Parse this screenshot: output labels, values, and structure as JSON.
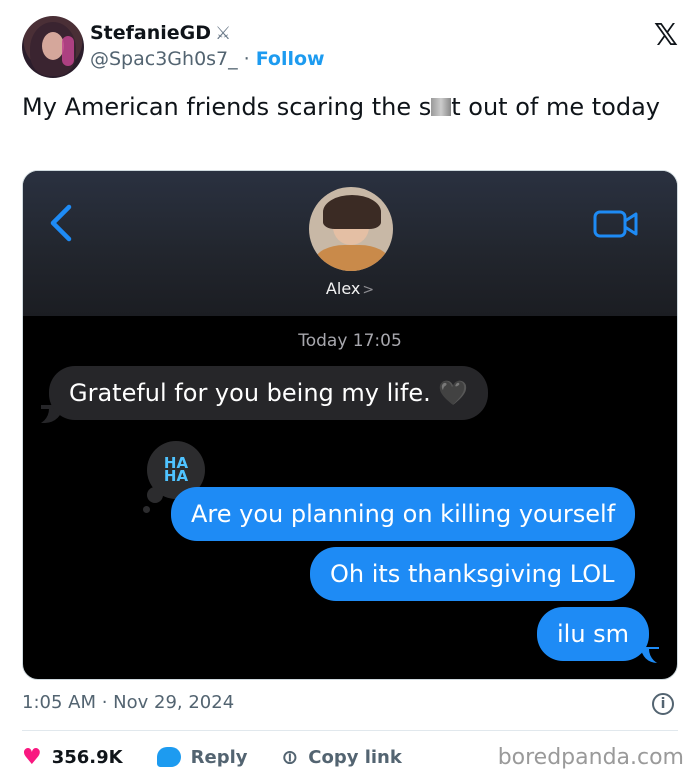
{
  "author": {
    "display_name": "StefanieGD",
    "badge_icon": "crossed-swords-icon",
    "handle": "@Spac3Gh0s7_",
    "separator": "·",
    "follow_label": "Follow"
  },
  "platform_logo": "𝕏",
  "tweet": {
    "text_before": "My American friends scaring the s",
    "text_after": "t out of me today"
  },
  "chat": {
    "contact_name": "Alex",
    "contact_chevron": ">",
    "timestamp": "Today 17:05",
    "messages": [
      {
        "direction": "incoming",
        "text": "Grateful for you being my life. 🖤"
      },
      {
        "direction": "outgoing",
        "text": "Are you planning on killing yourself"
      },
      {
        "direction": "outgoing",
        "text": "Oh its thanksgiving LOL"
      },
      {
        "direction": "outgoing",
        "text": "ilu sm"
      }
    ],
    "reaction": {
      "line1": "HA",
      "line2": "HA"
    }
  },
  "meta": {
    "time_date": "1:05 AM · Nov 29, 2024",
    "info": "i"
  },
  "actions": {
    "likes": "356.9K",
    "reply_label": "Reply",
    "copy_link_label": "Copy link"
  },
  "watermark": "boredpanda.com",
  "colors": {
    "follow_blue": "#1d9bf0",
    "imessage_blue": "#1e8bf5",
    "incoming_gray": "#262629",
    "like_pink": "#f91880"
  }
}
